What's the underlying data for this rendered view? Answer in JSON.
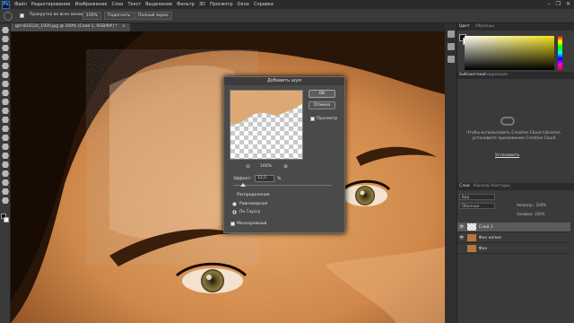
{
  "app": {
    "logo": "Ps"
  },
  "menu": [
    "Файл",
    "Редактирование",
    "Изображение",
    "Слои",
    "Текст",
    "Выделение",
    "Фильтр",
    "3D",
    "Просмотр",
    "Окно",
    "Справка"
  ],
  "window_controls": [
    "–",
    "❐",
    "✕"
  ],
  "options": {
    "scroll_all": "Прокрутка во всех окнах",
    "zoom": "100%",
    "fit": "Подогнать",
    "fill_screen": "Полный экран"
  },
  "document": {
    "tab_title": "girl-833124_1920.jpg @ 200% (Слой 1, RGB/8#) *",
    "tab_close": "×"
  },
  "panels": {
    "color_tab": "Цвет",
    "swatches_tab": "Образцы",
    "libraries_tab": "Библиотеки",
    "adjustments_tab": "Коррекция",
    "cc_message": "Чтобы использовать Creative Cloud Libraries, установите приложение Creative Cloud",
    "cc_install": "Установить",
    "layers_tab": "Слои",
    "channels_tab": "Каналы",
    "paths_tab": "Контуры",
    "kind_filter": "Вид",
    "blend_mode": "Обычные",
    "opacity_label": "Непрозр.: 100%",
    "fill_label": "Заливка: 100%",
    "layers": [
      {
        "name": "Слой 1"
      },
      {
        "name": "Фон копия"
      },
      {
        "name": "Фон"
      }
    ]
  },
  "dialog": {
    "title": "Добавить шум",
    "ok": "OK",
    "cancel": "Отмена",
    "preview_label": "Просмотр",
    "zoom_value": "100%",
    "amount_label": "Эффект:",
    "amount_value": "12,5",
    "amount_unit": "%",
    "distribution_label": "Распределение",
    "uniform_label": "Равномерная",
    "gaussian_label": "По Гауссу",
    "monochrome_label": "Монохромный"
  },
  "colors": {
    "skin": "#d38e4f",
    "hair": "#241208",
    "accent": "#2a77d6"
  }
}
